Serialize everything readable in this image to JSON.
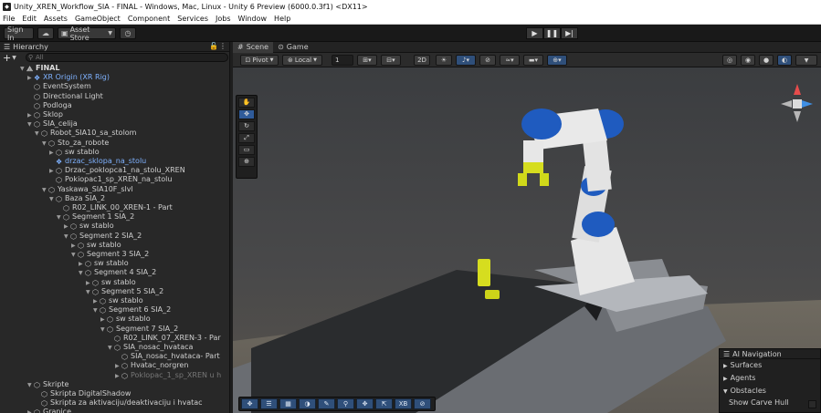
{
  "window": {
    "title": "Unity_XREN_Workflow_SIA - FINAL - Windows, Mac, Linux - Unity 6 Preview (6000.0.3f1) <DX11>"
  },
  "menu": [
    "File",
    "Edit",
    "Assets",
    "GameObject",
    "Component",
    "Services",
    "Jobs",
    "Window",
    "Help"
  ],
  "toolbar": {
    "sign_in": "Sign In",
    "asset_store": "Asset Store"
  },
  "hierarchy": {
    "tab": "Hierarchy",
    "search_placeholder": "All",
    "items": [
      {
        "label": "FINAL",
        "depth": 0,
        "icon": "unity-scene-icon",
        "expanded": true,
        "style": "scene"
      },
      {
        "label": "XR Origin (XR Rig)",
        "depth": 1,
        "icon": "prefab-icon",
        "expanded": false,
        "style": "blue"
      },
      {
        "label": "EventSystem",
        "depth": 1,
        "icon": "gameobject-icon"
      },
      {
        "label": "Directional Light",
        "depth": 1,
        "icon": "gameobject-icon"
      },
      {
        "label": "Podloga",
        "depth": 1,
        "icon": "gameobject-icon"
      },
      {
        "label": "Sklop",
        "depth": 1,
        "icon": "gameobject-icon",
        "expanded": false
      },
      {
        "label": "SIA_celija",
        "depth": 1,
        "icon": "gameobject-icon",
        "expanded": true
      },
      {
        "label": "Robot_SIA10_sa_stolom",
        "depth": 2,
        "icon": "gameobject-icon",
        "expanded": true
      },
      {
        "label": "Sto_za_robote",
        "depth": 3,
        "icon": "gameobject-icon",
        "expanded": true
      },
      {
        "label": "sw stablo",
        "depth": 4,
        "icon": "gameobject-icon",
        "expanded": false
      },
      {
        "label": "drzac_sklopa_na_stolu",
        "depth": 4,
        "icon": "prefab-icon",
        "style": "blue"
      },
      {
        "label": "Drzac_poklopca1_na_stolu_XREN",
        "depth": 4,
        "icon": "gameobject-icon",
        "expanded": false
      },
      {
        "label": "Pokiopac1_sp_XREN_na_stolu",
        "depth": 4,
        "icon": "gameobject-icon"
      },
      {
        "label": "Yaskawa_SIA10F_slvl",
        "depth": 3,
        "icon": "gameobject-icon",
        "expanded": true
      },
      {
        "label": "Baza SIA_2",
        "depth": 4,
        "icon": "gameobject-icon",
        "expanded": true
      },
      {
        "label": "R02_LINK_00_XREN-1 - Part",
        "depth": 5,
        "icon": "gameobject-icon"
      },
      {
        "label": "Segment 1 SIA_2",
        "depth": 5,
        "icon": "gameobject-icon",
        "expanded": true
      },
      {
        "label": "sw stablo",
        "depth": 6,
        "icon": "gameobject-icon",
        "expanded": false
      },
      {
        "label": "Segment 2 SIA_2",
        "depth": 6,
        "icon": "gameobject-icon",
        "expanded": true
      },
      {
        "label": "sw stablo",
        "depth": 7,
        "icon": "gameobject-icon",
        "expanded": false
      },
      {
        "label": "Segment 3 SIA_2",
        "depth": 7,
        "icon": "gameobject-icon",
        "expanded": true
      },
      {
        "label": "sw stablo",
        "depth": 8,
        "icon": "gameobject-icon",
        "expanded": false
      },
      {
        "label": "Segment 4 SIA_2",
        "depth": 8,
        "icon": "gameobject-icon",
        "expanded": true
      },
      {
        "label": "sw stablo",
        "depth": 9,
        "icon": "gameobject-icon",
        "expanded": false
      },
      {
        "label": "Segment 5 SIA_2",
        "depth": 9,
        "icon": "gameobject-icon",
        "expanded": true
      },
      {
        "label": "sw stablo",
        "depth": 10,
        "icon": "gameobject-icon",
        "expanded": false
      },
      {
        "label": "Segment 6 SIA_2",
        "depth": 10,
        "icon": "gameobject-icon",
        "expanded": true
      },
      {
        "label": "sw stablo",
        "depth": 11,
        "icon": "gameobject-icon",
        "expanded": false
      },
      {
        "label": "Segment 7 SIA_2",
        "depth": 11,
        "icon": "gameobject-icon",
        "expanded": true
      },
      {
        "label": "R02_LINK_07_XREN-3 - Par",
        "depth": 12,
        "icon": "gameobject-icon"
      },
      {
        "label": "SIA_nosac_hvataca",
        "depth": 12,
        "icon": "gameobject-icon",
        "expanded": true
      },
      {
        "label": "SIA_nosac_hvataca- Part",
        "depth": 13,
        "icon": "gameobject-icon"
      },
      {
        "label": "Hvatac_norgren",
        "depth": 13,
        "icon": "gameobject-icon",
        "expanded": false
      },
      {
        "label": "Poklopac_1_sp_XREN u h",
        "depth": 13,
        "icon": "gameobject-icon",
        "expanded": false,
        "style": "dim"
      },
      {
        "label": "Skripte",
        "depth": 1,
        "icon": "gameobject-icon",
        "expanded": true
      },
      {
        "label": "Skripta DigitalShadow",
        "depth": 2,
        "icon": "gameobject-icon"
      },
      {
        "label": "Skripta za aktivaciju/deaktivaciju i hvatac",
        "depth": 2,
        "icon": "gameobject-icon"
      },
      {
        "label": "Granice",
        "depth": 1,
        "icon": "gameobject-icon",
        "expanded": false
      }
    ]
  },
  "scene": {
    "tabs": [
      {
        "label": "Scene",
        "icon": "grid-icon"
      },
      {
        "label": "Game",
        "icon": "gamepad-icon"
      }
    ],
    "pivot": "Pivot",
    "local": "Local",
    "grid_snap_value": "1",
    "mode_2d": "2D"
  },
  "ai_navigation": {
    "title": "AI Navigation",
    "surfaces": "Surfaces",
    "agents": "Agents",
    "obstacles": "Obstacles",
    "show_carve_hull": "Show Carve Hull"
  },
  "bottom_tools": {
    "xb_label": "XB"
  },
  "colors": {
    "robot_blue": "#1f5bbf",
    "robot_white": "#e8e8e8",
    "gripper_yellow": "#d6dd1f",
    "table_dark": "#2b2d2f",
    "selection_blue": "#2f5b9a"
  }
}
